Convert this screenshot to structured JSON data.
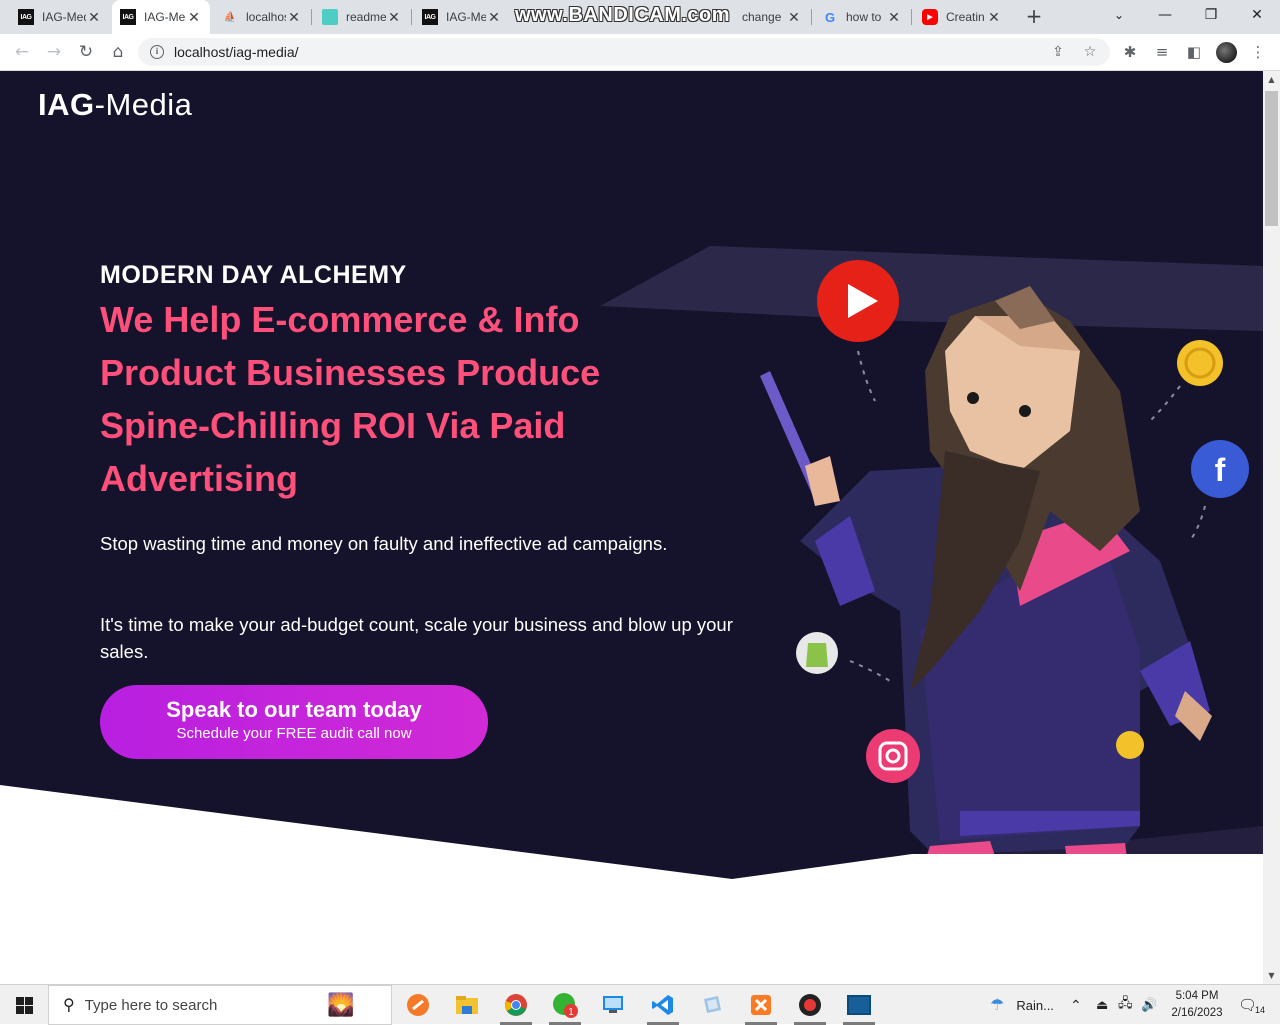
{
  "browser": {
    "tabs": [
      {
        "title": "IAG-Media",
        "icon": "iag-favicon",
        "active": false
      },
      {
        "title": "IAG-Media",
        "icon": "iag-favicon",
        "active": true
      },
      {
        "title": "localhost",
        "icon": "phpmyadmin-favicon",
        "active": false
      },
      {
        "title": "readme",
        "icon": "readme-favicon",
        "active": false
      },
      {
        "title": "IAG-Media",
        "icon": "iag-favicon",
        "active": false
      },
      {
        "title": "change",
        "icon": "page-favicon",
        "active": false
      },
      {
        "title": "how to",
        "icon": "google-favicon",
        "active": false
      },
      {
        "title": "Creatin",
        "icon": "youtube-favicon",
        "active": false
      }
    ],
    "fav_label": "IAG",
    "google_g": "G",
    "watermark": "www.BANDICAM.com",
    "new_tab_symbol": "+",
    "url": "localhost/iag-media/",
    "info_symbol": "i"
  },
  "site": {
    "logo_bold": "IAG",
    "logo_light": "-Media",
    "eyebrow": "MODERN DAY ALCHEMY",
    "headline": "We Help E-commerce & Info Product Businesses Produce Spine-Chilling ROI Via Paid Advertising",
    "paragraph1": "Stop wasting time and money on faulty and ineffective ad campaigns.",
    "paragraph2": "It's time to make your ad-budget count, scale your business and blow up your sales.",
    "cta_main": "Speak to our team today",
    "cta_sub": "Schedule your FREE audit call now",
    "colors": {
      "background": "#15122b",
      "headline": "#ff4f7b",
      "cta": "#c026d3"
    }
  },
  "taskbar": {
    "search_placeholder": "Type here to search",
    "weather": "Rain...",
    "time": "5:04 PM",
    "date": "2/16/2023",
    "notifications": "14",
    "chat_badge": "1",
    "apps": [
      "widgets-icon",
      "sublime-icon",
      "explorer-icon",
      "chrome-icon",
      "chat-icon",
      "remote-desktop-icon",
      "vscode-icon",
      "virtualbox-icon",
      "xampp-icon",
      "bandicam-icon",
      "terminal-icon"
    ]
  }
}
